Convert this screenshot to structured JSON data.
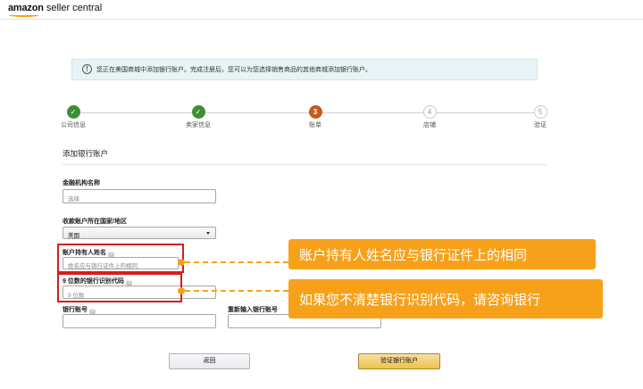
{
  "header": {
    "logo_brand": "amazon",
    "logo_product": "seller central",
    "accent_color": "#f29f05"
  },
  "info_banner": {
    "icon": "info-icon",
    "icon_glyph": "!",
    "text": "您正在美国商城中添加银行账户。完成注册后，您可以为您选择销售商品的其他商城添加银行账户。"
  },
  "stepper": {
    "steps": [
      {
        "number": "1",
        "label": "公司信息",
        "state": "done",
        "glyph": "✓"
      },
      {
        "number": "2",
        "label": "卖家信息",
        "state": "done",
        "glyph": "✓"
      },
      {
        "number": "3",
        "label": "账单",
        "state": "current",
        "glyph": "3"
      },
      {
        "number": "4",
        "label": "店铺",
        "state": "todo",
        "glyph": "4"
      },
      {
        "number": "5",
        "label": "验证",
        "state": "todo",
        "glyph": "5"
      }
    ]
  },
  "form": {
    "section_title": "添加银行账户",
    "institution": {
      "label": "金融机构名称",
      "placeholder": "选择"
    },
    "country": {
      "label": "收款账户所在国家/地区",
      "value": "美国"
    },
    "holder": {
      "label": "账户持有人姓名",
      "placeholder": "姓名应与银行证件上的相同",
      "help": "?"
    },
    "routing": {
      "label": "9 位数的银行识别代码",
      "placeholder": "9 位数",
      "help": "?"
    },
    "account": {
      "label": "银行账号",
      "help": "?",
      "value": ""
    },
    "account_confirm": {
      "label": "重新输入银行账号",
      "value": ""
    }
  },
  "callouts": {
    "holder_tip": "账户持有人姓名应与银行证件上的相同",
    "routing_tip": "如果您不清楚银行识别代码，请咨询银行",
    "color": "#f7a11b",
    "box_color": "#d61d1d"
  },
  "buttons": {
    "back": "返回",
    "verify": "验证银行账户"
  }
}
